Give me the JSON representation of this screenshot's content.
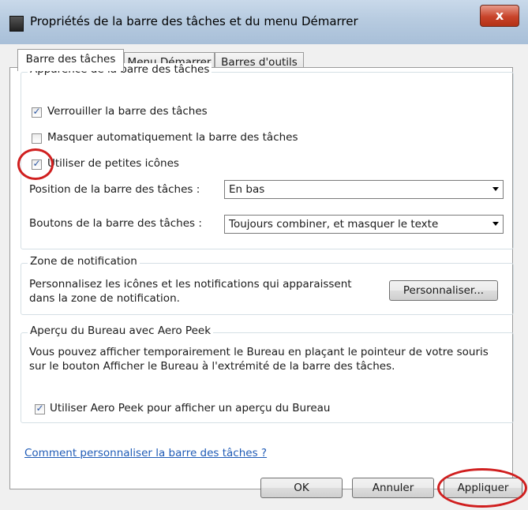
{
  "window": {
    "title": "Propriétés de la barre des tâches et du menu Démarrer",
    "close_label": "x"
  },
  "tabs": [
    {
      "label": "Barre des tâches",
      "active": true
    },
    {
      "label": "Menu Démarrer",
      "active": false
    },
    {
      "label": "Barres d'outils",
      "active": false
    }
  ],
  "appearance": {
    "group_label": "Apparence de la barre des tâches",
    "lock_label": "Verrouiller la barre des tâches",
    "lock_checked": true,
    "autohide_label": "Masquer automatiquement la barre des tâches",
    "autohide_checked": false,
    "small_icons_label": "Utiliser de petites icônes",
    "small_icons_checked": true,
    "position_label": "Position de la barre des tâches :",
    "position_value": "En bas",
    "buttons_label": "Boutons de la barre des tâches :",
    "buttons_value": "Toujours combiner, et masquer le texte"
  },
  "notification": {
    "group_label": "Zone de notification",
    "text_line1": "Personnalisez les icônes et les notifications qui apparaissent",
    "text_line2": "dans la zone de notification.",
    "customize_button": "Personnaliser..."
  },
  "aero": {
    "group_label": "Aperçu du Bureau avec Aero Peek",
    "text_line1": "Vous pouvez afficher temporairement le Bureau en plaçant le pointeur de votre souris",
    "text_line2": "sur le bouton Afficher le Bureau à l'extrémité de la barre des tâches.",
    "peek_label": "Utiliser Aero Peek pour afficher un aperçu du Bureau",
    "peek_checked": true
  },
  "help_link": "Comment personnaliser la barre des tâches ?",
  "footer": {
    "ok": "OK",
    "cancel": "Annuler",
    "apply": "Appliquer"
  },
  "colors": {
    "highlight_circle": "#d01f1f",
    "link": "#1f5bb6",
    "check_mark": "#2e58a3"
  }
}
